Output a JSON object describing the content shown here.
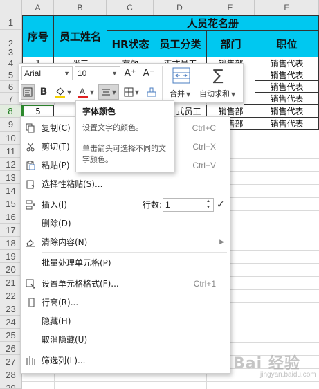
{
  "sheet": {
    "columns": [
      "A",
      "B",
      "C",
      "D",
      "E",
      "F"
    ],
    "rows": [
      "1",
      "2",
      "3",
      "4",
      "5",
      "6",
      "7",
      "8",
      "9",
      "10",
      "11",
      "12",
      "13",
      "14",
      "15",
      "16",
      "17",
      "18",
      "19",
      "20",
      "21",
      "22",
      "23",
      "24",
      "25",
      "26",
      "27",
      "28",
      "29"
    ],
    "title": "人员花名册",
    "headers": {
      "seq": "序号",
      "name": "员工姓名",
      "hr_status": "HR状态",
      "category": "员工分类",
      "dept": "部门",
      "position": "职位"
    },
    "row4": {
      "seq": "1",
      "name": "张三",
      "hr_status": "有效",
      "category": "正式员工",
      "dept": "销售部",
      "position": "销售代表"
    },
    "row5": {
      "position": "销售代表"
    },
    "row6": {
      "position": "销售代表"
    },
    "row7": {
      "position": "销售代表"
    },
    "row8": {
      "seq": "5",
      "category": "式员工",
      "dept": "销售部",
      "position": "销售代表"
    },
    "row9": {
      "dept": "销售部",
      "position": "销售代表"
    }
  },
  "mini_toolbar": {
    "font_name": "Arial",
    "font_size": "10",
    "grow_font": "A⁺",
    "shrink_font": "A⁻",
    "bold": "B",
    "merge_label": "合并",
    "autosum_label": "自动求和",
    "font_color_hex": "#e02020",
    "fill_color_hex": "#f5d000"
  },
  "tooltip": {
    "title": "字体颜色",
    "line1": "设置文字的颜色。",
    "line2": "单击箭头可选择不同的文字颜色。"
  },
  "context_menu": {
    "copy": {
      "label": "复制(C)",
      "shortcut": "Ctrl+C"
    },
    "cut": {
      "label": "剪切(T)",
      "shortcut": "Ctrl+X"
    },
    "paste": {
      "label": "粘贴(P)",
      "shortcut": "Ctrl+V"
    },
    "paste_special": {
      "label": "选择性粘贴(S)..."
    },
    "insert": {
      "label": "插入(I)",
      "rows_label": "行数:",
      "rows_value": "1"
    },
    "delete": {
      "label": "删除(D)"
    },
    "clear": {
      "label": "清除内容(N)"
    },
    "batch": {
      "label": "批量处理单元格(P)"
    },
    "format": {
      "label": "设置单元格格式(F)...",
      "shortcut": "Ctrl+1"
    },
    "row_height": {
      "label": "行高(R)..."
    },
    "hide": {
      "label": "隐藏(H)"
    },
    "unhide": {
      "label": "取消隐藏(U)"
    },
    "filter": {
      "label": "筛选列(L)..."
    }
  },
  "watermark": {
    "text": "Bai 经验",
    "sub": "jingyan.baidu.com"
  }
}
